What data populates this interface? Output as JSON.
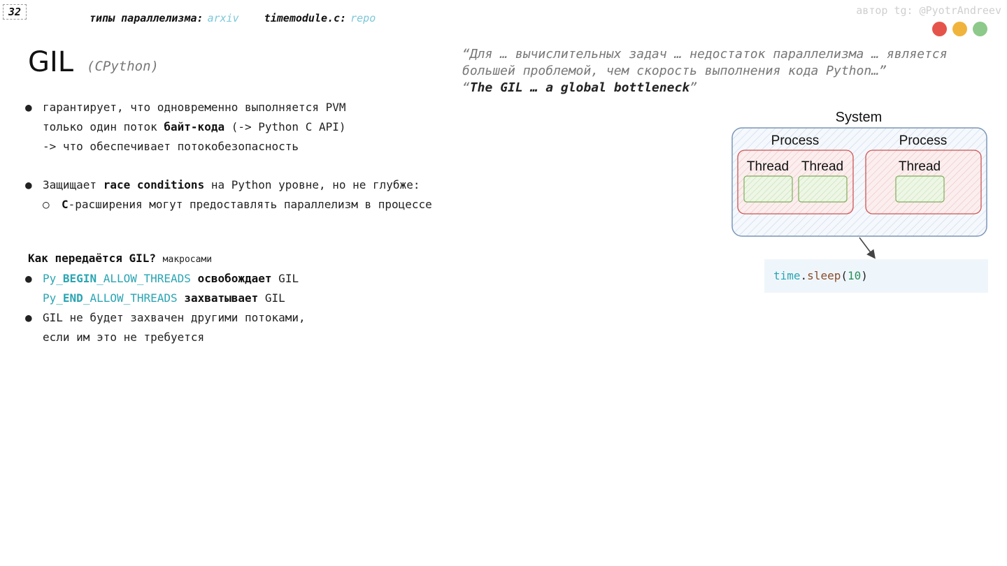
{
  "slide": {
    "page_number": "32",
    "links": [
      {
        "label": "типы параллелизма:",
        "link": "arxiv"
      },
      {
        "label": "timemodule.c:",
        "link": "repo"
      }
    ],
    "author": "автор tg: @PyotrAndreev",
    "window_dots": [
      "#e5544b",
      "#f0b43c",
      "#8dc98a"
    ],
    "title": "GIL",
    "subtitle": "(CPython)",
    "quote": {
      "line1": "“Для … вычислительных задач … недостаток параллелизма … является",
      "line2": "большей проблемой, чем скорость выполнения кода Python…”",
      "line3_open": "“",
      "line3_bold": "The GIL … a global bottleneck",
      "line3_close": "”"
    },
    "bullets1": {
      "b1_l1": "гарантирует, что одновременно выполняется PVM",
      "b1_l2_pre": "только один поток ",
      "b1_l2_bold": "байт-кода",
      "b1_l2_post": " (-> Python C API)",
      "b1_l3": "-> что обеспечивает потокобезопасность",
      "b2_pre": "Защищает ",
      "b2_bold": "race conditions",
      "b2_post": " на Python уровне, но не глубже:",
      "sub_bold": "C",
      "sub_rest": "-расширения могут предоставлять параллелизм в процессе"
    },
    "section2": {
      "heading": "Как передаётся GIL?",
      "heading_small": "макросами",
      "m1_pre": "Py_",
      "m1_bold": "BEGIN",
      "m1_post": "_ALLOW_THREADS",
      "m1_action": "освобождает",
      "m1_tail": " GIL",
      "m2_pre": "Py_",
      "m2_bold": "END",
      "m2_post": "_ALLOW_THREADS",
      "m2_action": "захватывает",
      "m2_tail": " GIL",
      "b3_l1": "GIL не будет захвачен другими потоками,",
      "b3_l2": "если им это не требуется"
    },
    "diagram": {
      "system": "System",
      "process1": "Process",
      "process2": "Process",
      "thread1": "Thread",
      "thread2": "Thread",
      "thread3": "Thread"
    },
    "code": {
      "module": "time",
      "dot": ".",
      "func": "sleep",
      "open": "(",
      "arg": "10",
      "close": ")"
    }
  }
}
